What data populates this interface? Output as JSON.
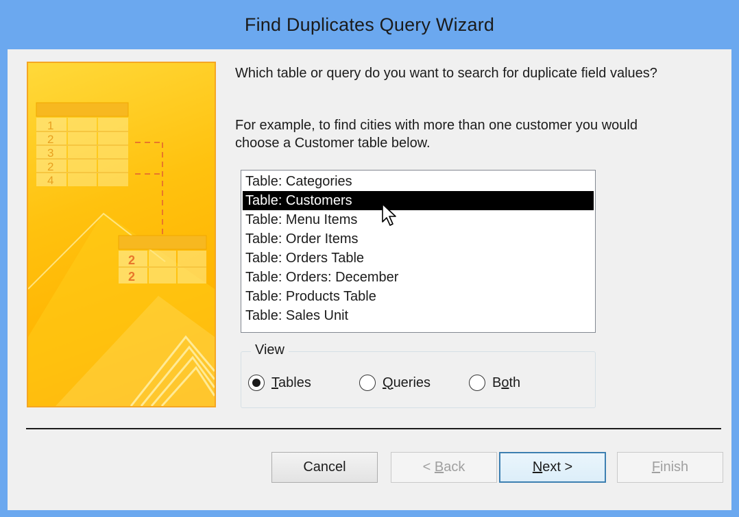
{
  "window": {
    "title": "Find Duplicates Query Wizard",
    "titlebar_color": "#6ba8ef"
  },
  "prompt": {
    "question": "Which table or query do you want to search for duplicate field values?",
    "example_line1": "For example, to find cities with more than one customer you would",
    "example_line2": "choose a Customer table below."
  },
  "table_list": {
    "items": [
      {
        "label": "Table: Categories",
        "selected": false
      },
      {
        "label": "Table: Customers",
        "selected": true
      },
      {
        "label": "Table: Menu Items",
        "selected": false
      },
      {
        "label": "Table: Order Items",
        "selected": false
      },
      {
        "label": "Table: Orders Table",
        "selected": false
      },
      {
        "label": "Table: Orders: December",
        "selected": false
      },
      {
        "label": "Table: Products Table",
        "selected": false
      },
      {
        "label": "Table: Sales Unit",
        "selected": false
      }
    ]
  },
  "view_group": {
    "legend": "View",
    "options": [
      {
        "label": "Tables",
        "access_key": "T",
        "rest": "ables",
        "checked": true
      },
      {
        "label": "Queries",
        "access_key": "Q",
        "rest": "ueries",
        "checked": false
      },
      {
        "label": "Both",
        "prefix": "B",
        "access_key": "o",
        "rest": "th",
        "checked": false
      }
    ]
  },
  "illustration": {
    "row_numbers": [
      "1",
      "2",
      "3",
      "2",
      "4"
    ],
    "duplicate_numbers": [
      "2",
      "2"
    ],
    "accent_color": "#e8762b"
  },
  "buttons": {
    "cancel": {
      "label": "Cancel"
    },
    "back": {
      "prefix": "< ",
      "access_key": "B",
      "rest": "ack",
      "enabled": false
    },
    "next": {
      "access_key": "N",
      "rest": "ext >",
      "enabled": true
    },
    "finish": {
      "access_key": "F",
      "rest": "inish",
      "enabled": false
    }
  }
}
